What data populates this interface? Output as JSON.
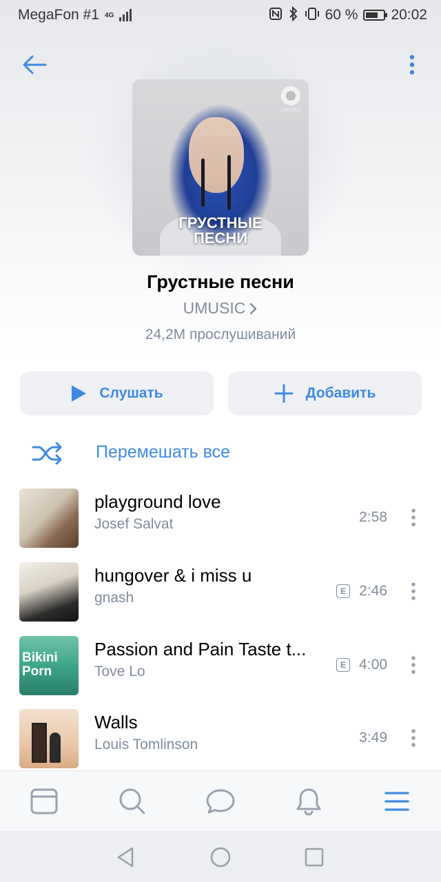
{
  "status_bar": {
    "carrier": "MegaFon #1",
    "network": "4G",
    "battery_percent": "60 %",
    "time": "20:02",
    "icons": [
      "nfc-icon",
      "bluetooth-icon",
      "vibrate-icon",
      "battery-icon",
      "signal-icon"
    ]
  },
  "header": {
    "back_icon": "arrow-left-icon",
    "more_icon": "vertical-dots-icon"
  },
  "playlist": {
    "cover_text_line1": "ГРУСТНЫЕ",
    "cover_text_line2": "ПЕСНИ",
    "cover_logo_text": "UMUSIC",
    "title": "Грустные песни",
    "owner": "UMUSIC",
    "listens": "24,2M прослушиваний"
  },
  "actions": {
    "listen_label": "Слушать",
    "add_label": "Добавить",
    "shuffle_label": "Перемешать все"
  },
  "tracks": [
    {
      "title": "playground love",
      "artist": "Josef Salvat",
      "duration": "2:58",
      "explicit": false
    },
    {
      "title": "hungover & i miss u",
      "artist": "gnash",
      "duration": "2:46",
      "explicit": true,
      "explicit_mark": "E"
    },
    {
      "title": "Passion and Pain Taste t...",
      "artist": "Tove Lo",
      "duration": "4:00",
      "explicit": true,
      "explicit_mark": "E",
      "cover_text": "Bikini Porn"
    },
    {
      "title": "Walls",
      "artist": "Louis Tomlinson",
      "duration": "3:49",
      "explicit": false
    }
  ],
  "tabbar": {
    "items": [
      "news-tab-icon",
      "search-tab-icon",
      "messages-tab-icon",
      "notifications-tab-icon",
      "menu-tab-icon"
    ]
  },
  "colors": {
    "accent": "#3f8ae0",
    "secondary_text": "#818c99",
    "button_bg": "#eef0f3"
  }
}
